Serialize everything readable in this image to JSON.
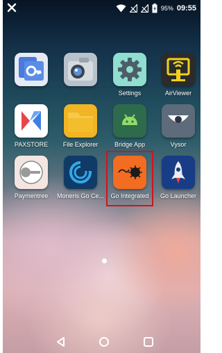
{
  "status_bar": {
    "battery_percent": "95%",
    "time": "09:55",
    "icons": [
      "tools-icon",
      "wifi-icon",
      "signal-off-icon",
      "signal-off-icon",
      "battery-charging-icon"
    ]
  },
  "apps": [
    {
      "label": "",
      "icon": "key-app-icon"
    },
    {
      "label": "",
      "icon": "camera-app-icon"
    },
    {
      "label": "Settings",
      "icon": "gear-icon"
    },
    {
      "label": "AirViewer",
      "icon": "airviewer-icon"
    },
    {
      "label": "PAXSTORE",
      "icon": "paxstore-icon"
    },
    {
      "label": "File Explorer",
      "icon": "folder-icon"
    },
    {
      "label": "Bridge App",
      "icon": "android-icon"
    },
    {
      "label": "Vysor",
      "icon": "vysor-icon"
    },
    {
      "label": "Paymentree",
      "icon": "paymentree-icon"
    },
    {
      "label": "Moneris Go Ce...",
      "icon": "moneris-icon"
    },
    {
      "label": "Go Integrated",
      "icon": "go-integrated-icon",
      "highlighted": true
    },
    {
      "label": "Go Launcher",
      "icon": "rocket-icon"
    }
  ],
  "nav_bar": {
    "icons": [
      "back-icon",
      "home-icon",
      "recents-icon"
    ]
  },
  "colors": {
    "highlight_border": "#d0141c",
    "label_text": "#ffffff"
  }
}
